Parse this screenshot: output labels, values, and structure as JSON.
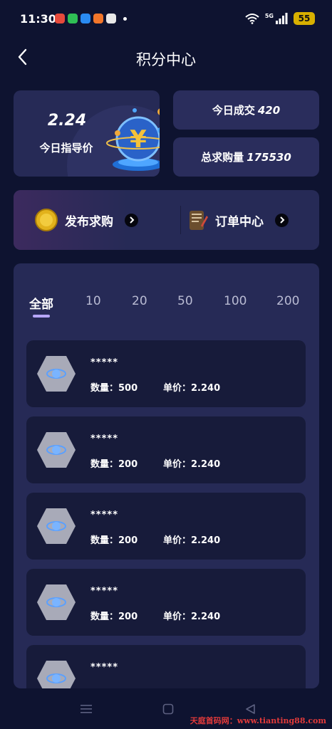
{
  "status_bar": {
    "time": "11:30",
    "network": "5G",
    "battery": "55",
    "app_icon_colors": [
      "#e64a3b",
      "#2fbf55",
      "#2a8bf2",
      "#f2762a",
      "#e8e8e8"
    ]
  },
  "header": {
    "title": "积分中心",
    "back_icon": "chevron-left-icon"
  },
  "stats": {
    "guide_price": "2.24",
    "guide_price_label": "今日指导价",
    "today_deals_label": "今日成交",
    "today_deals_value": "420",
    "total_demand_label": "总求购量",
    "total_demand_value": "175530"
  },
  "actions": {
    "publish_label": "发布求购",
    "orders_label": "订单中心"
  },
  "tabs": [
    "全部",
    "10",
    "20",
    "50",
    "100",
    "200"
  ],
  "active_tab": "全部",
  "items": [
    {
      "name": "*****",
      "qty_label": "数量：",
      "qty": "500",
      "price_label": "单价：",
      "price": "2.240"
    },
    {
      "name": "*****",
      "qty_label": "数量：",
      "qty": "200",
      "price_label": "单价：",
      "price": "2.240"
    },
    {
      "name": "*****",
      "qty_label": "数量：",
      "qty": "200",
      "price_label": "单价：",
      "price": "2.240"
    },
    {
      "name": "*****",
      "qty_label": "数量：",
      "qty": "200",
      "price_label": "单价：",
      "price": "2.240"
    },
    {
      "name": "*****"
    }
  ],
  "watermark": "天庭首码网：www.tianting88.com",
  "colors": {
    "background": "#0e1330",
    "card": "#262a56",
    "item": "#171b3a",
    "tab_indicator": "#b6a6ff",
    "coin_gold": "#e2b21c"
  }
}
